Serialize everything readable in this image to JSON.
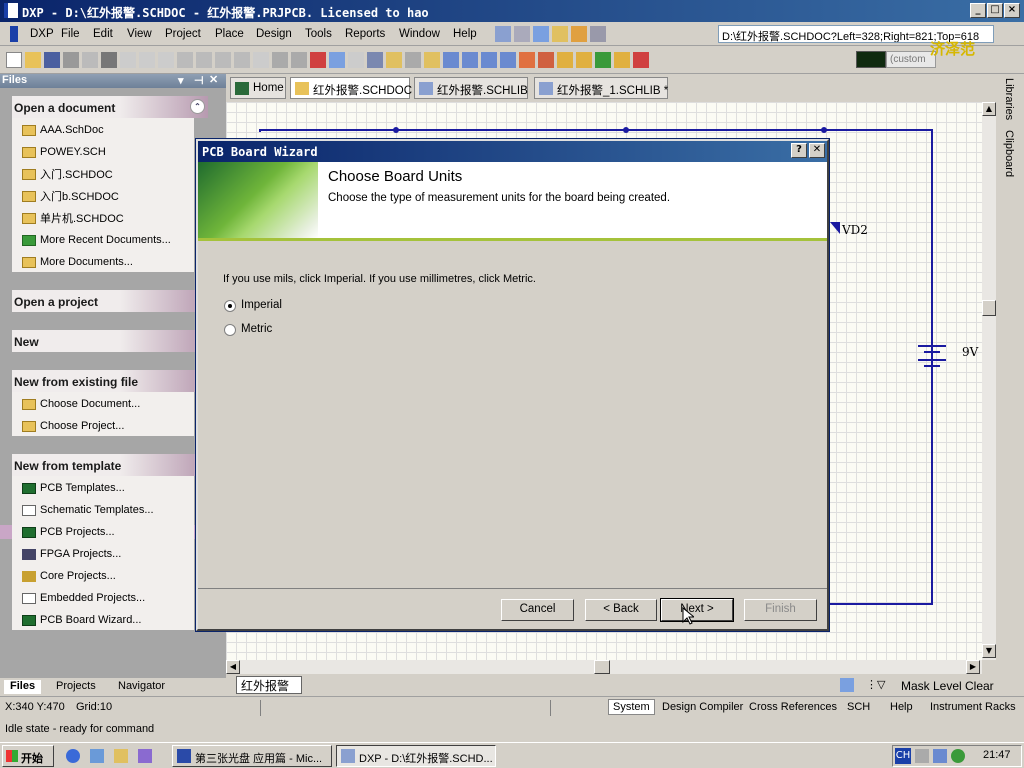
{
  "window": {
    "title": "DXP - D:\\红外报警.SCHDOC - 红外报警.PRJPCB. Licensed to hao",
    "controls": [
      "_",
      "□",
      "×"
    ]
  },
  "menubar": {
    "items": [
      "DXP",
      "File",
      "Edit",
      "View",
      "Project",
      "Place",
      "Design",
      "Tools",
      "Reports",
      "Window",
      "Help"
    ],
    "path_value": "D:\\红外报警.SCHDOC?Left=328;Right=821;Top=618"
  },
  "toolbar": {
    "custom_label": "(custom",
    "watermark": "济泽范"
  },
  "files_panel": {
    "header": "Files",
    "sections": [
      {
        "title": "Open a document",
        "items": [
          "AAA.SchDoc",
          "POWEY.SCH",
          "入门.SCHDOC",
          "入门b.SCHDOC",
          "单片机.SCHDOC",
          "More Recent Documents...",
          "More Documents..."
        ]
      },
      {
        "title": "Open a project",
        "items": []
      },
      {
        "title": "New",
        "items": []
      },
      {
        "title": "New from existing file",
        "items": [
          "Choose Document...",
          "Choose Project..."
        ]
      },
      {
        "title": "New from template",
        "items": [
          "PCB Templates...",
          "Schematic Templates...",
          "PCB Projects...",
          "FPGA Projects...",
          "Core Projects...",
          "Embedded Projects...",
          "PCB Board Wizard..."
        ]
      }
    ],
    "bottom_tabs": [
      "Files",
      "Projects",
      "Navigator"
    ]
  },
  "doc_tabs": [
    "Home",
    "红外报警.SCHDOC",
    "红外报警.SCHLIB",
    "红外报警_1.SCHLIB *"
  ],
  "side_panel": [
    "Libraries",
    "Clipboard"
  ],
  "schematic": {
    "labels": [
      "VD2",
      "9V"
    ],
    "sheet_tab": "红外报警"
  },
  "bottom_right": {
    "mask_level": "Mask Level",
    "clear": "Clear"
  },
  "dialog": {
    "title": "PCB Board Wizard",
    "heading": "Choose Board Units",
    "subheading": "Choose the type of measurement units for the board being created.",
    "instruction": "If you use mils, click Imperial. If you use millimetres, click Metric.",
    "options": [
      {
        "label": "Imperial",
        "selected": true
      },
      {
        "label": "Metric",
        "selected": false
      }
    ],
    "buttons": {
      "cancel": "Cancel",
      "back": "< Back",
      "next": "Next >",
      "finish": "Finish"
    }
  },
  "status": {
    "coords": "X:340 Y:470",
    "grid": "Grid:10",
    "state": "Idle state - ready for command",
    "tabs": [
      "System",
      "Design Compiler",
      "Cross References",
      "SCH",
      "Help",
      "Instrument Racks"
    ]
  },
  "taskbar": {
    "start": "开始",
    "tasks": [
      "第三张光盘 应用篇 - Mic...",
      "DXP - D:\\红外报警.SCHD..."
    ],
    "tray_lang": "CH",
    "clock": "21:47"
  }
}
